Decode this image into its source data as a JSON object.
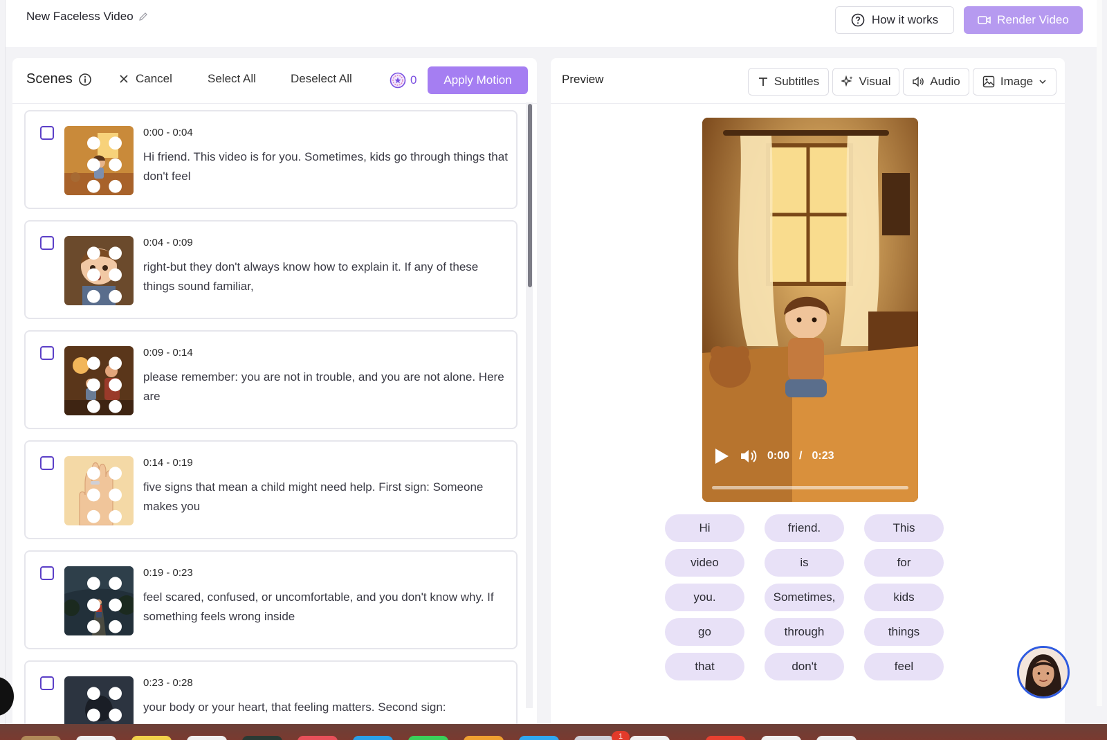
{
  "header": {
    "title": "New Faceless Video",
    "how_it_works": "How it works",
    "render_video": "Render Video"
  },
  "scenes": {
    "title": "Scenes",
    "cancel": "Cancel",
    "select_all": "Select All",
    "deselect_all": "Deselect All",
    "credits": "0",
    "apply_motion": "Apply Motion",
    "items": [
      {
        "time": "0:00 - 0:04",
        "text": "Hi friend. This video is for you. Sometimes, kids go through things that don't feel"
      },
      {
        "time": "0:04 - 0:09",
        "text": "right-but they don't always know how to explain it. If any of these things sound familiar,"
      },
      {
        "time": "0:09 - 0:14",
        "text": "please remember: you are not in trouble, and you are not alone. Here are"
      },
      {
        "time": "0:14 - 0:19",
        "text": "five signs that mean a child might need help. First sign: Someone makes you"
      },
      {
        "time": "0:19 - 0:23",
        "text": "feel scared, confused, or uncomfortable, and you don't know why. If something feels wrong inside"
      },
      {
        "time": "0:23 - 0:28",
        "text": "your body or your heart, that feeling matters. Second sign:"
      }
    ]
  },
  "preview": {
    "title": "Preview",
    "tools": {
      "subtitles": "Subtitles",
      "visual": "Visual",
      "audio": "Audio",
      "image": "Image"
    },
    "player": {
      "current_time": "0:00",
      "total_time": "0:23",
      "progress": 0
    },
    "words": [
      "Hi",
      "friend.",
      "This",
      "video",
      "is",
      "for",
      "you.",
      "Sometimes,",
      "kids",
      "go",
      "through",
      "things",
      "that",
      "don't",
      "feel"
    ]
  },
  "colors": {
    "accent": "#a57ef2",
    "render_button": "#b69af0",
    "word_chip": "#e8e1f7",
    "checkbox": "#5b3fc7"
  },
  "dock": {
    "badge": "1"
  }
}
